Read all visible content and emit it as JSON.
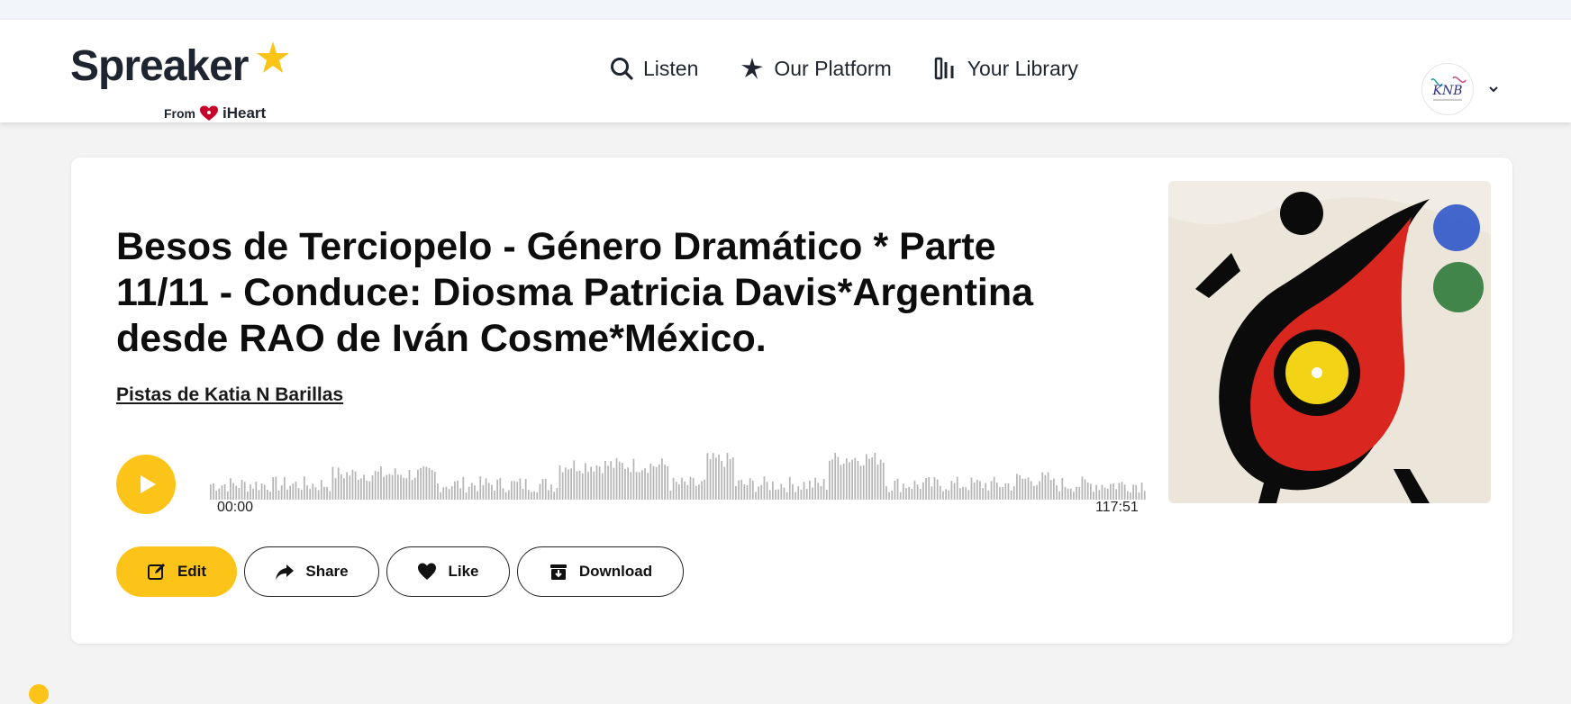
{
  "brand": {
    "name": "Spreaker",
    "from_label": "From",
    "partner": "iHeart",
    "accent_color": "#fcc419"
  },
  "nav": {
    "items": [
      {
        "label": "Listen",
        "icon": "search-icon"
      },
      {
        "label": "Our Platform",
        "icon": "sparkle-icon"
      },
      {
        "label": "Your Library",
        "icon": "library-icon"
      }
    ]
  },
  "user": {
    "avatar_text": "KNB",
    "menu_icon": "chevron-down-icon"
  },
  "episode": {
    "title": "Besos de Terciopelo - Género Dramático * Parte 11/11 - Conduce: Diosma Patricia Davis*Argentina desde RAO de Iván Cosme*México.",
    "podcast": "Pistas de Katia N Barillas",
    "time_start": "00:00",
    "time_end": "117:51",
    "artwork": "abstract-painting"
  },
  "actions": {
    "edit": "Edit",
    "share": "Share",
    "like": "Like",
    "download": "Download"
  }
}
